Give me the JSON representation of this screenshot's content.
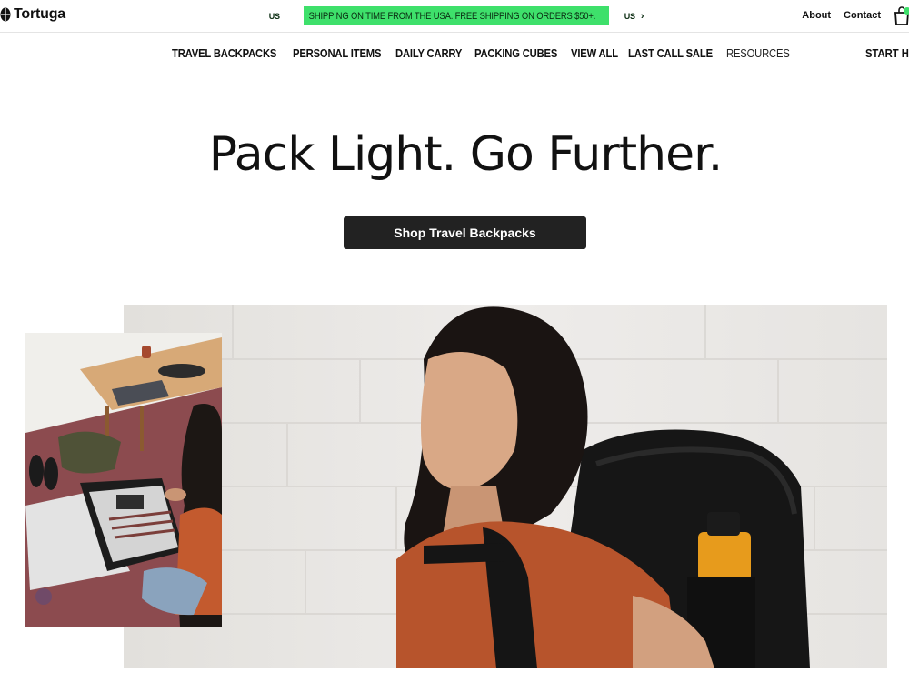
{
  "brand": {
    "name": "Tortuga"
  },
  "promo": {
    "flag_left": "US",
    "text": "SHIPPING ON TIME FROM THE USA. FREE SHIPPING ON ORDERS $50+.",
    "flag_right": "US",
    "chevron": "›",
    "color": "#3ee06b"
  },
  "util": {
    "about": "About",
    "contact": "Contact",
    "cart_icon": "shopping-bag-icon"
  },
  "nav": {
    "items": [
      "TRAVEL BACKPACKS",
      "PERSONAL ITEMS",
      "DAILY CARRY",
      "PACKING CUBES",
      "VIEW ALL",
      "LAST CALL SALE",
      "RESOURCES"
    ],
    "start": "START HERE"
  },
  "hero": {
    "title": "Pack Light. Go Further.",
    "cta": "Shop Travel Backpacks"
  },
  "colors": {
    "cta_bg": "#222222",
    "accent_green": "#3ee06b"
  }
}
